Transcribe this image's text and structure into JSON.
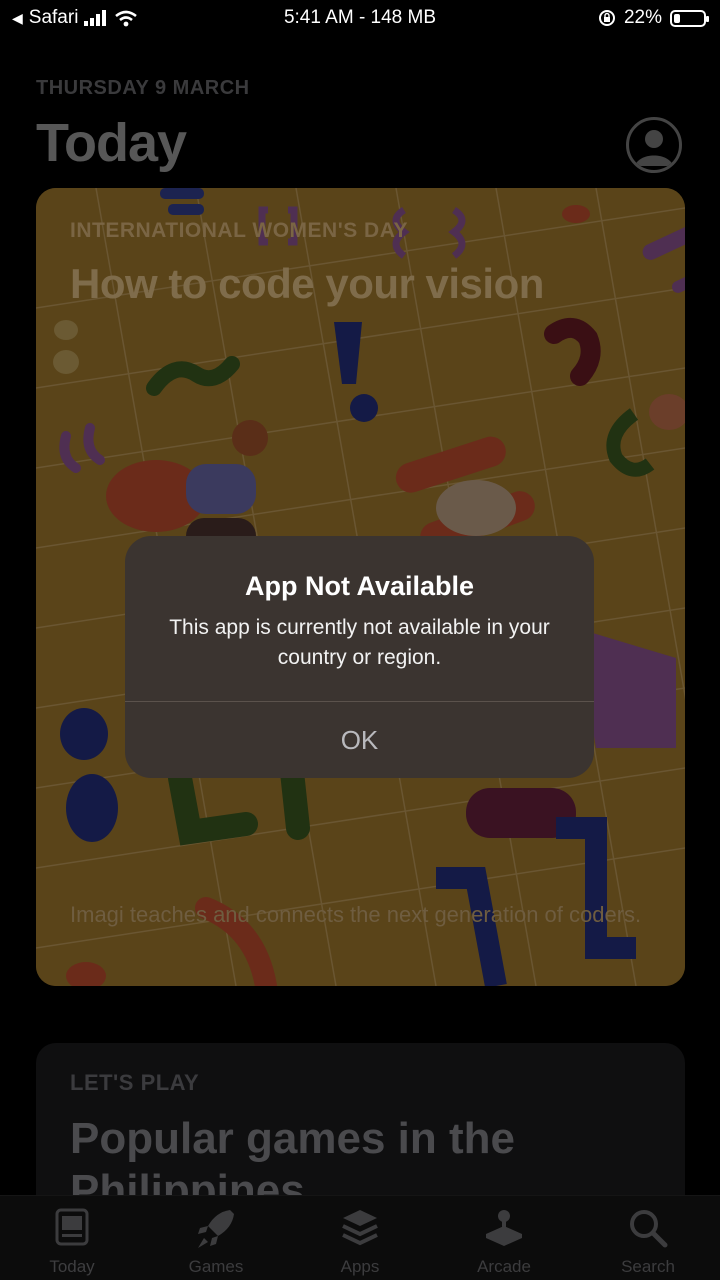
{
  "status_bar": {
    "back_app": "Safari",
    "time_memory": "5:41 AM - 148 MB",
    "battery_percent": "22%",
    "battery_level": 0.22
  },
  "today": {
    "date": "THURSDAY 9 MARCH",
    "title": "Today"
  },
  "feature_card": {
    "eyebrow": "INTERNATIONAL WOMEN'S DAY",
    "headline": "How to code your vision",
    "description": "Imagi teaches and connects the next generation of coders."
  },
  "second_card": {
    "eyebrow": "LET'S PLAY",
    "headline": "Popular games in the Philippines"
  },
  "tabs": [
    {
      "label": "Today",
      "icon": "today-icon"
    },
    {
      "label": "Games",
      "icon": "rocket-icon"
    },
    {
      "label": "Apps",
      "icon": "layers-icon"
    },
    {
      "label": "Arcade",
      "icon": "joystick-icon"
    },
    {
      "label": "Search",
      "icon": "search-icon"
    }
  ],
  "alert": {
    "title": "App Not Available",
    "message": "This app is currently not available in your country or region.",
    "ok_label": "OK"
  }
}
